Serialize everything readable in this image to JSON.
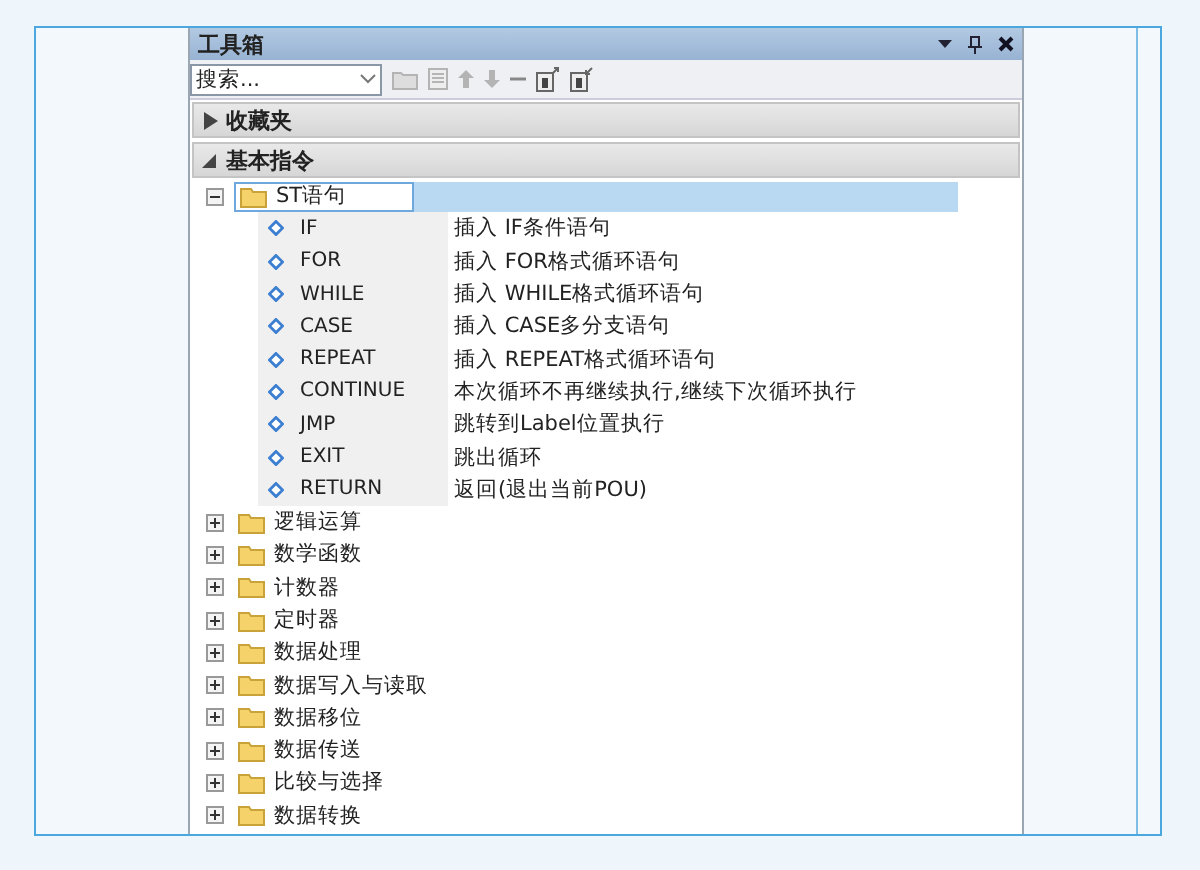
{
  "panel": {
    "title": "工具箱",
    "search": {
      "placeholder": "搜索..."
    },
    "sections": [
      {
        "label": "收藏夹",
        "expanded": false
      },
      {
        "label": "基本指令",
        "expanded": true
      }
    ],
    "tree": [
      {
        "label": "ST语句",
        "expanded": true,
        "selected": true,
        "children": [
          {
            "name": "IF",
            "description": "插入 IF条件语句"
          },
          {
            "name": "FOR",
            "description": "插入 FOR格式循环语句"
          },
          {
            "name": "WHILE",
            "description": "插入 WHILE格式循环语句"
          },
          {
            "name": "CASE",
            "description": "插入 CASE多分支语句"
          },
          {
            "name": "REPEAT",
            "description": "插入 REPEAT格式循环语句"
          },
          {
            "name": "CONTINUE",
            "description": "本次循环不再继续执行,继续下次循环执行"
          },
          {
            "name": "JMP",
            "description": "跳转到Label位置执行"
          },
          {
            "name": "EXIT",
            "description": "跳出循环"
          },
          {
            "name": "RETURN",
            "description": "返回(退出当前POU)"
          }
        ]
      },
      {
        "label": "逻辑运算",
        "expanded": false,
        "selected": false
      },
      {
        "label": "数学函数",
        "expanded": false,
        "selected": false
      },
      {
        "label": "计数器",
        "expanded": false,
        "selected": false
      },
      {
        "label": "定时器",
        "expanded": false,
        "selected": false
      },
      {
        "label": "数据处理",
        "expanded": false,
        "selected": false
      },
      {
        "label": "数据写入与读取",
        "expanded": false,
        "selected": false
      },
      {
        "label": "数据移位",
        "expanded": false,
        "selected": false
      },
      {
        "label": "数据传送",
        "expanded": false,
        "selected": false
      },
      {
        "label": "比较与选择",
        "expanded": false,
        "selected": false
      },
      {
        "label": "数据转换",
        "expanded": false,
        "selected": false
      }
    ]
  }
}
